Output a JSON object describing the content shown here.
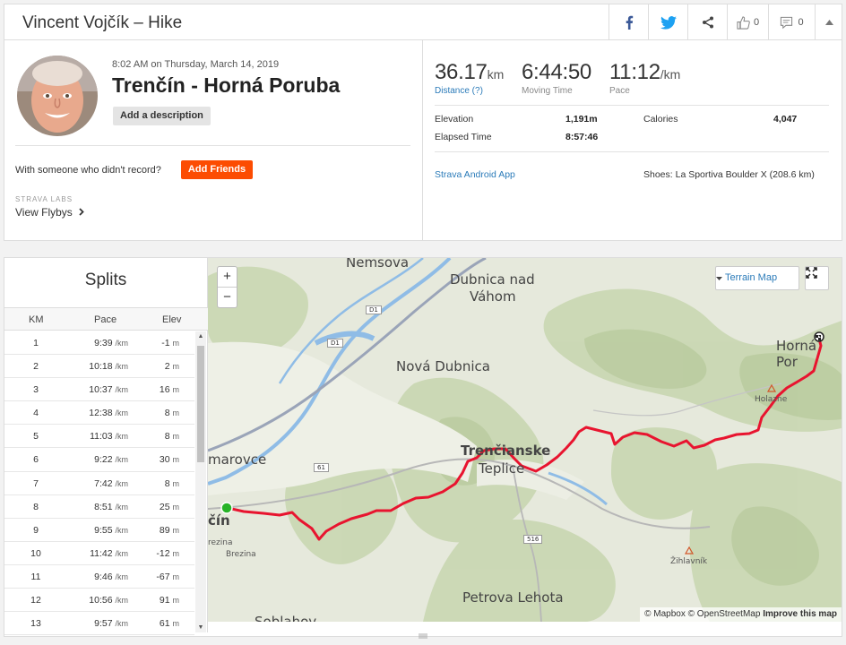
{
  "header": {
    "title": "Vincent Vojčík – Hike",
    "kudos_count": "0",
    "comments_count": "0"
  },
  "activity": {
    "datetime": "8:02 AM on Thursday, March 14, 2019",
    "name": "Trenčín - Horná Poruba",
    "add_description": "Add a description",
    "with_someone": "With someone who didn't record?",
    "add_friends": "Add Friends",
    "labs_label": "STRAVA LABS",
    "flybys": "View Flybys"
  },
  "stats": {
    "distance": {
      "value": "36.17",
      "unit": "km",
      "label": "Distance (?)"
    },
    "moving_time": {
      "value": "6:44:50",
      "label": "Moving Time"
    },
    "pace": {
      "value": "11:12",
      "unit": "/km",
      "label": "Pace"
    },
    "elevation_label": "Elevation",
    "elevation_value": "1,191m",
    "calories_label": "Calories",
    "calories_value": "4,047",
    "elapsed_label": "Elapsed Time",
    "elapsed_value": "8:57:46",
    "app": "Strava Android App",
    "shoes": "Shoes: La Sportiva Boulder X (208.6 km)"
  },
  "splits": {
    "title": "Splits",
    "headers": {
      "km": "KM",
      "pace": "Pace",
      "elev": "Elev"
    },
    "pace_unit": "/km",
    "elev_unit": "m",
    "rows": [
      {
        "km": "1",
        "pace": "9:39",
        "elev": "-1"
      },
      {
        "km": "2",
        "pace": "10:18",
        "elev": "2"
      },
      {
        "km": "3",
        "pace": "10:37",
        "elev": "16"
      },
      {
        "km": "4",
        "pace": "12:38",
        "elev": "8"
      },
      {
        "km": "5",
        "pace": "11:03",
        "elev": "8"
      },
      {
        "km": "6",
        "pace": "9:22",
        "elev": "30"
      },
      {
        "km": "7",
        "pace": "7:42",
        "elev": "8"
      },
      {
        "km": "8",
        "pace": "8:51",
        "elev": "25"
      },
      {
        "km": "9",
        "pace": "9:55",
        "elev": "89"
      },
      {
        "km": "10",
        "pace": "11:42",
        "elev": "-12"
      },
      {
        "km": "11",
        "pace": "9:46",
        "elev": "-67"
      },
      {
        "km": "12",
        "pace": "10:56",
        "elev": "91"
      },
      {
        "km": "13",
        "pace": "9:57",
        "elev": "61"
      }
    ]
  },
  "map": {
    "zoom_in": "+",
    "zoom_out": "−",
    "style_button": "Terrain Map",
    "attribution_mapbox": "© Mapbox",
    "attribution_osm": "© OpenStreetMap",
    "improve": "Improve this map",
    "labels": {
      "nemsova": "Nemsova",
      "dubnica": "Dubnica nad",
      "vahom": "Váhom",
      "nova_dubnica": "Nová Dubnica",
      "trencianske": "Trenčianske",
      "teplice": "Teplice",
      "horna_por": "Horná Por",
      "holazne": "Holazne",
      "zihlavnik": "Žihlavník",
      "petrova_lehota": "Petrova Lehota",
      "soblahov": "Soblahov",
      "skalka": "marovce",
      "trencin": "čín",
      "brezina1": "rezina",
      "brezina2": "Brezina",
      "road_d1a": "D1",
      "road_d1b": "D1",
      "road_61": "61",
      "road_516": "516"
    },
    "colors": {
      "route": "#e8142f",
      "start": "#27b327",
      "water": "#8fbce6"
    }
  }
}
